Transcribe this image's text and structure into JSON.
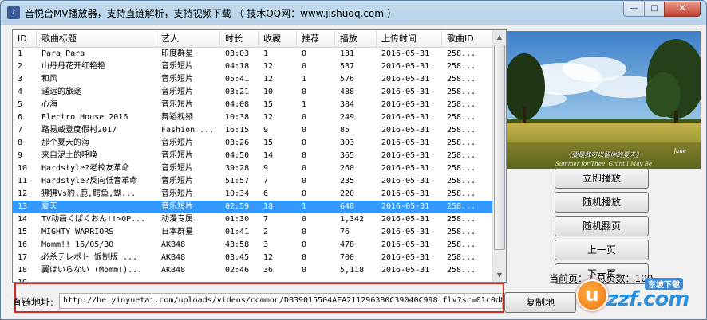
{
  "window": {
    "title": "音悦台MV播放器，支持直链解析，支持视频下载 （ 技术QQ网：www.jishuqq.com ）",
    "min_glyph": "—",
    "max_glyph": "□",
    "close_glyph": "✕"
  },
  "table": {
    "columns": [
      {
        "label": "ID",
        "w": 30
      },
      {
        "label": "歌曲标题",
        "w": 150
      },
      {
        "label": "艺人",
        "w": 80
      },
      {
        "label": "时长",
        "w": 48
      },
      {
        "label": "收藏",
        "w": 48
      },
      {
        "label": "推荐",
        "w": 48
      },
      {
        "label": "播放",
        "w": 52
      },
      {
        "label": "上传时间",
        "w": 82
      },
      {
        "label": "歌曲ID",
        "w": 65
      }
    ],
    "rows": [
      [
        "1",
        "Para Para",
        "印度群星",
        "03:03",
        "1",
        "0",
        "131",
        "2016-05-31",
        "258..."
      ],
      [
        "2",
        "山丹丹花开红艳艳",
        "音乐短片",
        "04:18",
        "12",
        "0",
        "537",
        "2016-05-31",
        "258..."
      ],
      [
        "3",
        "和风",
        "音乐短片",
        "05:41",
        "12",
        "1",
        "576",
        "2016-05-31",
        "258..."
      ],
      [
        "4",
        "遥远的旅途",
        "音乐短片",
        "03:21",
        "10",
        "0",
        "488",
        "2016-05-31",
        "258..."
      ],
      [
        "5",
        "心海",
        "音乐短片",
        "04:08",
        "15",
        "1",
        "384",
        "2016-05-31",
        "258..."
      ],
      [
        "6",
        "Electro House 2016",
        "舞蹈视频",
        "10:38",
        "12",
        "0",
        "249",
        "2016-05-31",
        "258..."
      ],
      [
        "7",
        "路易威登度假村2017",
        "Fashion ...",
        "16:15",
        "9",
        "0",
        "85",
        "2016-05-31",
        "258..."
      ],
      [
        "8",
        "那个夏天的海",
        "音乐短片",
        "03:26",
        "15",
        "0",
        "303",
        "2016-05-31",
        "258..."
      ],
      [
        "9",
        "来自泥土的呼唤",
        "音乐短片",
        "04:50",
        "14",
        "0",
        "365",
        "2016-05-31",
        "258..."
      ],
      [
        "10",
        "Hardstyle?老校友革命",
        "音乐短片",
        "39:28",
        "9",
        "0",
        "260",
        "2016-05-31",
        "258..."
      ],
      [
        "11",
        "Hardstyle?反向低音革命",
        "音乐短片",
        "51:57",
        "7",
        "0",
        "235",
        "2016-05-31",
        "258..."
      ],
      [
        "12",
        "狒狒Vs豹,鹿,鳄鱼,蝴...",
        "音乐短片",
        "10:34",
        "6",
        "0",
        "220",
        "2016-05-31",
        "258..."
      ],
      [
        "13",
        "夏天",
        "音乐短片",
        "02:59",
        "18",
        "1",
        "648",
        "2016-05-31",
        "258..."
      ],
      [
        "14",
        "TV动画くぱくおん!!>OP...",
        "动漫专属",
        "01:30",
        "7",
        "0",
        "1,342",
        "2016-05-31",
        "258..."
      ],
      [
        "15",
        "MIGHTY WARRIORS",
        "日本群星",
        "01:41",
        "2",
        "0",
        "76",
        "2016-05-31",
        "258..."
      ],
      [
        "16",
        "Momm!! 16/05/30",
        "AKB48",
        "43:58",
        "3",
        "0",
        "478",
        "2016-05-31",
        "258..."
      ],
      [
        "17",
        "必杀テレポト 饭制版 ...",
        "AKB48",
        "03:45",
        "12",
        "0",
        "700",
        "2016-05-31",
        "258..."
      ],
      [
        "18",
        "翼はいらない (Momm!)...",
        "AKB48",
        "02:46",
        "36",
        "0",
        "5,118",
        "2016-05-31",
        "258..."
      ],
      [
        "19",
        "",
        "",
        "",
        "",
        "",
        "",
        "",
        ""
      ]
    ],
    "selected_index": 12
  },
  "preview": {
    "caption": "《要是我可以留你的夏天》",
    "subcaption": "Summer for Thee, Grant I May Be",
    "signature": "Jane"
  },
  "buttons": {
    "play_now": "立即播放",
    "random_play": "随机播放",
    "random_page": "随机翻页",
    "prev_page": "上一页",
    "next_page": "下一页",
    "copy_link": "复制地"
  },
  "paging": {
    "text": "当前页：1  总页数：100"
  },
  "url": {
    "label": "直链地址:",
    "value": "http://he.yinyuetai.com/uploads/videos/common/DB39015504AFA211296380C39040C998.flv?sc=01c0d8"
  },
  "watermark": {
    "letter": "u",
    "text": "zzf.com",
    "tag": "东坡下载"
  },
  "colors": {
    "selection": "#3399ff",
    "highlight_border": "#d9271c",
    "watermark_blue": "#2f8fd8"
  }
}
